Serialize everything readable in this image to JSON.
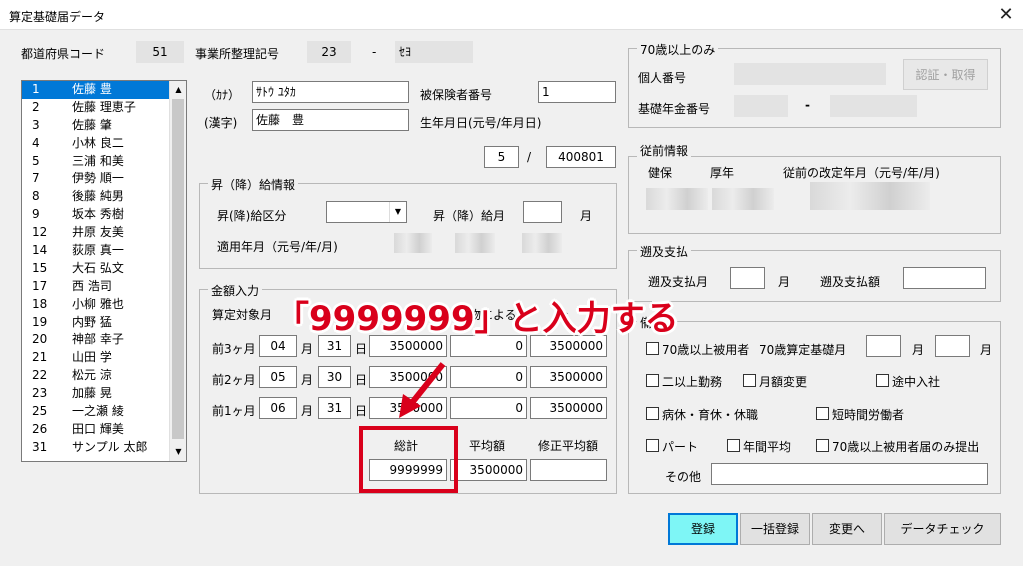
{
  "window": {
    "title": "算定基礎届データ",
    "close_label": "✕"
  },
  "header": {
    "pref_code_label": "都道府県コード",
    "pref_code_value": "51",
    "office_label": "事業所整理記号",
    "office_code1": "23",
    "dash": "-",
    "office_code2": "ｾﾖ"
  },
  "employee_list": [
    {
      "no": "1",
      "name": "佐藤 豊",
      "selected": true
    },
    {
      "no": "2",
      "name": "佐藤 理恵子"
    },
    {
      "no": "3",
      "name": "佐藤 肇"
    },
    {
      "no": "4",
      "name": "小林 良二"
    },
    {
      "no": "5",
      "name": "三浦 和美"
    },
    {
      "no": "7",
      "name": "伊勢 順一"
    },
    {
      "no": "8",
      "name": "後藤 純男"
    },
    {
      "no": "9",
      "name": "坂本 秀樹"
    },
    {
      "no": "12",
      "name": "井原 友美"
    },
    {
      "no": "14",
      "name": "荻原 真一"
    },
    {
      "no": "15",
      "name": "大石 弘文"
    },
    {
      "no": "17",
      "name": "西 浩司"
    },
    {
      "no": "18",
      "name": "小柳 雅也"
    },
    {
      "no": "19",
      "name": "内野 猛"
    },
    {
      "no": "20",
      "name": "神部 幸子"
    },
    {
      "no": "21",
      "name": "山田 学"
    },
    {
      "no": "22",
      "name": "松元 涼"
    },
    {
      "no": "23",
      "name": "加藤 晃"
    },
    {
      "no": "25",
      "name": "一之瀬 綾"
    },
    {
      "no": "26",
      "name": "田口 輝美"
    },
    {
      "no": "31",
      "name": "サンプル 太郎"
    }
  ],
  "person": {
    "kana_label": "（ｶﾅ）",
    "kana_value": "ｻﾄｳ ﾕﾀｶ",
    "kanji_label": "(漢字)",
    "kanji_value": "佐藤　豊",
    "insured_no_label": "被保険者番号",
    "insured_no_value": "1",
    "birth_label": "生年月日(元号/年月日)",
    "birth_era": "5",
    "birth_slash": "/",
    "birth_date": "400801"
  },
  "raise": {
    "title": "昇（降）給情報",
    "class_label": "昇(降)給区分",
    "class_value": "",
    "month_label": "昇（降）給月",
    "month_value": "",
    "month_unit": "月",
    "apply_label": "適用年月（元号/年/月)"
  },
  "amount": {
    "title": "金額入力",
    "target_month_label": "算定対象月",
    "header_partial": "物による",
    "header_partial2": "合",
    "day_unit": "日",
    "rows": [
      {
        "label": "前3ヶ月",
        "month": "04",
        "month_unit": "月",
        "days": "31",
        "cash": "3500000",
        "goods": "0",
        "total": "3500000"
      },
      {
        "label": "前2ヶ月",
        "month": "05",
        "month_unit": "月",
        "days": "30",
        "cash": "3500000",
        "goods": "0",
        "total": "3500000"
      },
      {
        "label": "前1ヶ月",
        "month": "06",
        "month_unit": "月",
        "days": "31",
        "cash": "3500000",
        "goods": "0",
        "total": "3500000"
      }
    ],
    "sum_label": "総計",
    "sum_value": "9999999",
    "avg_label": "平均額",
    "avg_value": "3500000",
    "adj_avg_label": "修正平均額",
    "adj_avg_value": ""
  },
  "over70": {
    "title": "70歳以上のみ",
    "personal_no_label": "個人番号",
    "auth_button": "認証・取得",
    "pension_label": "基礎年金番号",
    "dash": "-"
  },
  "previous": {
    "title": "従前情報",
    "health_label": "健保",
    "pension_label": "厚年",
    "revision_label": "従前の改定年月（元号/年/月)"
  },
  "retro": {
    "title": "遡及支払",
    "month_label": "遡及支払月",
    "month_unit": "月",
    "amount_label": "遡及支払額"
  },
  "remarks": {
    "title": "備考",
    "over70_label": "70歳以上被用者",
    "over70_base_label": "70歳算定基礎月",
    "month_unit": "月",
    "multi_work": "二以上勤務",
    "monthly_change": "月額変更",
    "mid_join": "途中入社",
    "leave": "病休・育休・休職",
    "short_time": "短時間労働者",
    "part": "パート",
    "annual_avg": "年間平均",
    "over70_only": "70歳以上被用者届のみ提出",
    "other_label": "その他"
  },
  "buttons": {
    "register": "登録",
    "bulk_register": "一括登録",
    "change": "変更へ",
    "data_check": "データチェック"
  },
  "annotation": {
    "text": "「9999999」と入力する",
    "color": "#d9001b"
  }
}
